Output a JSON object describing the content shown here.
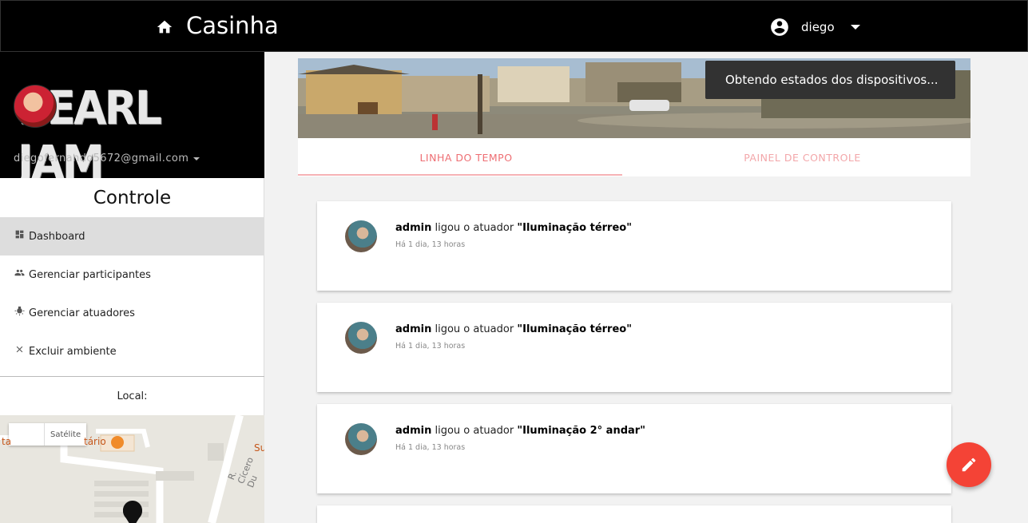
{
  "topbar": {
    "title": "Casinha",
    "home_icon": "home-icon",
    "user": {
      "name": "diego",
      "icon": "account-circle-icon"
    }
  },
  "sidebar": {
    "logo_text": "PEARL JAM",
    "email": "diegofernando5672@gmail.com",
    "section_title": "Controle",
    "items": [
      {
        "label": "Dashboard",
        "icon": "dashboard-icon"
      },
      {
        "label": "Gerenciar participantes",
        "icon": "people-icon"
      },
      {
        "label": "Gerenciar atuadores",
        "icon": "bulb-icon"
      },
      {
        "label": "Excluir ambiente",
        "icon": "close-icon"
      }
    ],
    "local_label": "Local:",
    "map": {
      "toggle_satellite": "Satélite",
      "place_label": "tário",
      "street_label": "R. Cícero Du",
      "side_label": "Su"
    }
  },
  "toast": {
    "text": "Obtendo estados dos dispositivos..."
  },
  "tabs": [
    {
      "label": "LINHA DO TEMPO"
    },
    {
      "label": "PAINEL DE CONTROLE"
    }
  ],
  "timeline": [
    {
      "user": "admin",
      "action": " ligou o atuador ",
      "target": "\"Iluminação térreo\"",
      "time": "Há 1 dia, 13 horas"
    },
    {
      "user": "admin",
      "action": " ligou o atuador ",
      "target": "\"Iluminação térreo\"",
      "time": "Há 1 dia, 13 horas"
    },
    {
      "user": "admin",
      "action": " ligou o atuador ",
      "target": "\"Iluminação 2° andar\"",
      "time": "Há 1 dia, 13 horas"
    }
  ],
  "colors": {
    "accent": "#ee6e73",
    "fab": "#f44336",
    "topbar": "#000000"
  }
}
